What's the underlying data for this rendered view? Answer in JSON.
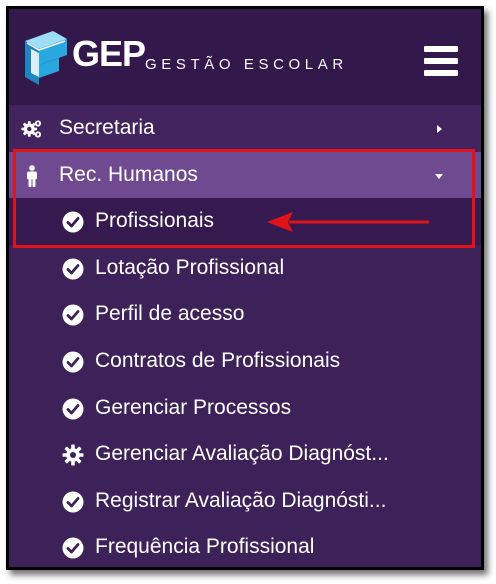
{
  "header": {
    "logo_text": "GEP",
    "logo_subtitle": "GESTÃO ESCOLAR"
  },
  "menu": {
    "secretaria": {
      "label": "Secretaria",
      "icon": "gears-icon"
    },
    "rec_humanos": {
      "label": "Rec. Humanos",
      "icon": "person-icon",
      "expanded": true
    },
    "sub_items": [
      {
        "label": "Profissionais",
        "icon": "check-circle-icon",
        "selected": true
      },
      {
        "label": "Lotação Profissional",
        "icon": "check-circle-icon"
      },
      {
        "label": "Perfil de acesso",
        "icon": "check-circle-icon"
      },
      {
        "label": "Contratos de Profissionais",
        "icon": "check-circle-icon"
      },
      {
        "label": "Gerenciar Processos",
        "icon": "check-circle-icon"
      },
      {
        "label": "Gerenciar Avaliação Diagnóst...",
        "icon": "gear-icon"
      },
      {
        "label": "Registrar Avaliação Diagnósti...",
        "icon": "check-circle-icon"
      },
      {
        "label": "Frequência Profissional",
        "icon": "check-circle-icon"
      }
    ]
  },
  "colors": {
    "header_bg": "#33184c",
    "menu_bg": "#3d2159",
    "active_bg": "#6f4a91",
    "selected_bg": "#35194f",
    "annotation_red": "#e0131b",
    "logo_cyan": "#29a8e0"
  }
}
